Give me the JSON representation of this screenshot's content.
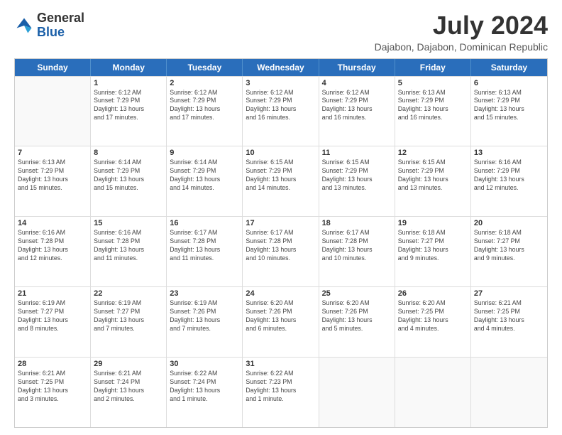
{
  "header": {
    "logo_general": "General",
    "logo_blue": "Blue",
    "month_title": "July 2024",
    "location": "Dajabon, Dajabon, Dominican Republic"
  },
  "calendar": {
    "days_of_week": [
      "Sunday",
      "Monday",
      "Tuesday",
      "Wednesday",
      "Thursday",
      "Friday",
      "Saturday"
    ],
    "rows": [
      [
        {
          "day": "",
          "info": ""
        },
        {
          "day": "1",
          "info": "Sunrise: 6:12 AM\nSunset: 7:29 PM\nDaylight: 13 hours\nand 17 minutes."
        },
        {
          "day": "2",
          "info": "Sunrise: 6:12 AM\nSunset: 7:29 PM\nDaylight: 13 hours\nand 17 minutes."
        },
        {
          "day": "3",
          "info": "Sunrise: 6:12 AM\nSunset: 7:29 PM\nDaylight: 13 hours\nand 16 minutes."
        },
        {
          "day": "4",
          "info": "Sunrise: 6:12 AM\nSunset: 7:29 PM\nDaylight: 13 hours\nand 16 minutes."
        },
        {
          "day": "5",
          "info": "Sunrise: 6:13 AM\nSunset: 7:29 PM\nDaylight: 13 hours\nand 16 minutes."
        },
        {
          "day": "6",
          "info": "Sunrise: 6:13 AM\nSunset: 7:29 PM\nDaylight: 13 hours\nand 15 minutes."
        }
      ],
      [
        {
          "day": "7",
          "info": "Sunrise: 6:13 AM\nSunset: 7:29 PM\nDaylight: 13 hours\nand 15 minutes."
        },
        {
          "day": "8",
          "info": "Sunrise: 6:14 AM\nSunset: 7:29 PM\nDaylight: 13 hours\nand 15 minutes."
        },
        {
          "day": "9",
          "info": "Sunrise: 6:14 AM\nSunset: 7:29 PM\nDaylight: 13 hours\nand 14 minutes."
        },
        {
          "day": "10",
          "info": "Sunrise: 6:15 AM\nSunset: 7:29 PM\nDaylight: 13 hours\nand 14 minutes."
        },
        {
          "day": "11",
          "info": "Sunrise: 6:15 AM\nSunset: 7:29 PM\nDaylight: 13 hours\nand 13 minutes."
        },
        {
          "day": "12",
          "info": "Sunrise: 6:15 AM\nSunset: 7:29 PM\nDaylight: 13 hours\nand 13 minutes."
        },
        {
          "day": "13",
          "info": "Sunrise: 6:16 AM\nSunset: 7:29 PM\nDaylight: 13 hours\nand 12 minutes."
        }
      ],
      [
        {
          "day": "14",
          "info": "Sunrise: 6:16 AM\nSunset: 7:28 PM\nDaylight: 13 hours\nand 12 minutes."
        },
        {
          "day": "15",
          "info": "Sunrise: 6:16 AM\nSunset: 7:28 PM\nDaylight: 13 hours\nand 11 minutes."
        },
        {
          "day": "16",
          "info": "Sunrise: 6:17 AM\nSunset: 7:28 PM\nDaylight: 13 hours\nand 11 minutes."
        },
        {
          "day": "17",
          "info": "Sunrise: 6:17 AM\nSunset: 7:28 PM\nDaylight: 13 hours\nand 10 minutes."
        },
        {
          "day": "18",
          "info": "Sunrise: 6:17 AM\nSunset: 7:28 PM\nDaylight: 13 hours\nand 10 minutes."
        },
        {
          "day": "19",
          "info": "Sunrise: 6:18 AM\nSunset: 7:27 PM\nDaylight: 13 hours\nand 9 minutes."
        },
        {
          "day": "20",
          "info": "Sunrise: 6:18 AM\nSunset: 7:27 PM\nDaylight: 13 hours\nand 9 minutes."
        }
      ],
      [
        {
          "day": "21",
          "info": "Sunrise: 6:19 AM\nSunset: 7:27 PM\nDaylight: 13 hours\nand 8 minutes."
        },
        {
          "day": "22",
          "info": "Sunrise: 6:19 AM\nSunset: 7:27 PM\nDaylight: 13 hours\nand 7 minutes."
        },
        {
          "day": "23",
          "info": "Sunrise: 6:19 AM\nSunset: 7:26 PM\nDaylight: 13 hours\nand 7 minutes."
        },
        {
          "day": "24",
          "info": "Sunrise: 6:20 AM\nSunset: 7:26 PM\nDaylight: 13 hours\nand 6 minutes."
        },
        {
          "day": "25",
          "info": "Sunrise: 6:20 AM\nSunset: 7:26 PM\nDaylight: 13 hours\nand 5 minutes."
        },
        {
          "day": "26",
          "info": "Sunrise: 6:20 AM\nSunset: 7:25 PM\nDaylight: 13 hours\nand 4 minutes."
        },
        {
          "day": "27",
          "info": "Sunrise: 6:21 AM\nSunset: 7:25 PM\nDaylight: 13 hours\nand 4 minutes."
        }
      ],
      [
        {
          "day": "28",
          "info": "Sunrise: 6:21 AM\nSunset: 7:25 PM\nDaylight: 13 hours\nand 3 minutes."
        },
        {
          "day": "29",
          "info": "Sunrise: 6:21 AM\nSunset: 7:24 PM\nDaylight: 13 hours\nand 2 minutes."
        },
        {
          "day": "30",
          "info": "Sunrise: 6:22 AM\nSunset: 7:24 PM\nDaylight: 13 hours\nand 1 minute."
        },
        {
          "day": "31",
          "info": "Sunrise: 6:22 AM\nSunset: 7:23 PM\nDaylight: 13 hours\nand 1 minute."
        },
        {
          "day": "",
          "info": ""
        },
        {
          "day": "",
          "info": ""
        },
        {
          "day": "",
          "info": ""
        }
      ]
    ]
  }
}
